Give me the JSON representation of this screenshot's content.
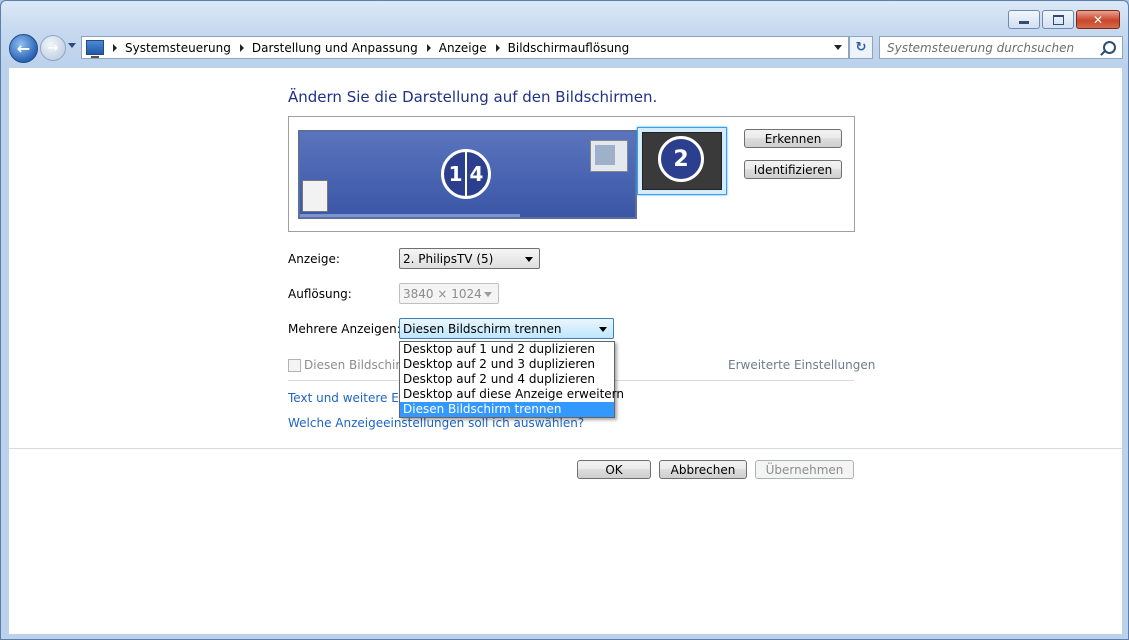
{
  "window": {
    "caption_buttons": [
      "minimize-icon",
      "maximize-icon",
      "close-icon"
    ],
    "close_glyph": "✕"
  },
  "nav": {
    "back_glyph": "←",
    "forward_glyph": "→",
    "breadcrumbs": [
      "Systemsteuerung",
      "Darstellung und Anpassung",
      "Anzeige",
      "Bildschirmauflösung"
    ],
    "refresh_glyph": "↻",
    "search_placeholder": "Systemsteuerung durchsuchen"
  },
  "main": {
    "heading": "Ändern Sie die Darstellung auf den Bildschirmen.",
    "monitors": {
      "monitor1_label_a": "1",
      "monitor1_label_b": "4",
      "monitor2_label": "2"
    },
    "detect_button": "Erkennen",
    "identify_button": "Identifizieren",
    "display_label": "Anzeige:",
    "display_value": "2. PhilipsTV (5)",
    "resolution_label": "Auflösung:",
    "resolution_value": "3840 × 1024",
    "multi_label": "Mehrere Anzeigen:",
    "multi_value": "Diesen Bildschirm trennen",
    "multi_options": [
      "Desktop auf 1 und 2 duplizieren",
      "Desktop auf 2 und 3 duplizieren",
      "Desktop auf 2 und 4 duplizieren",
      "Desktop auf diese Anzeige erweitern",
      "Diesen Bildschirm trennen"
    ],
    "multi_selected_index": 4,
    "checkbox_label": "Diesen Bildschirm",
    "advanced_link": "Erweiterte Einstellungen",
    "text_link": "Text und weitere Elen",
    "help_link": "Welche Anzeigeeinstellungen soll ich auswählen?",
    "ok_button": "OK",
    "cancel_button": "Abbrechen",
    "apply_button": "Übernehmen"
  },
  "colors": {
    "heading": "#1e3287",
    "link": "#1e64c8",
    "selection": "#3399ff"
  }
}
